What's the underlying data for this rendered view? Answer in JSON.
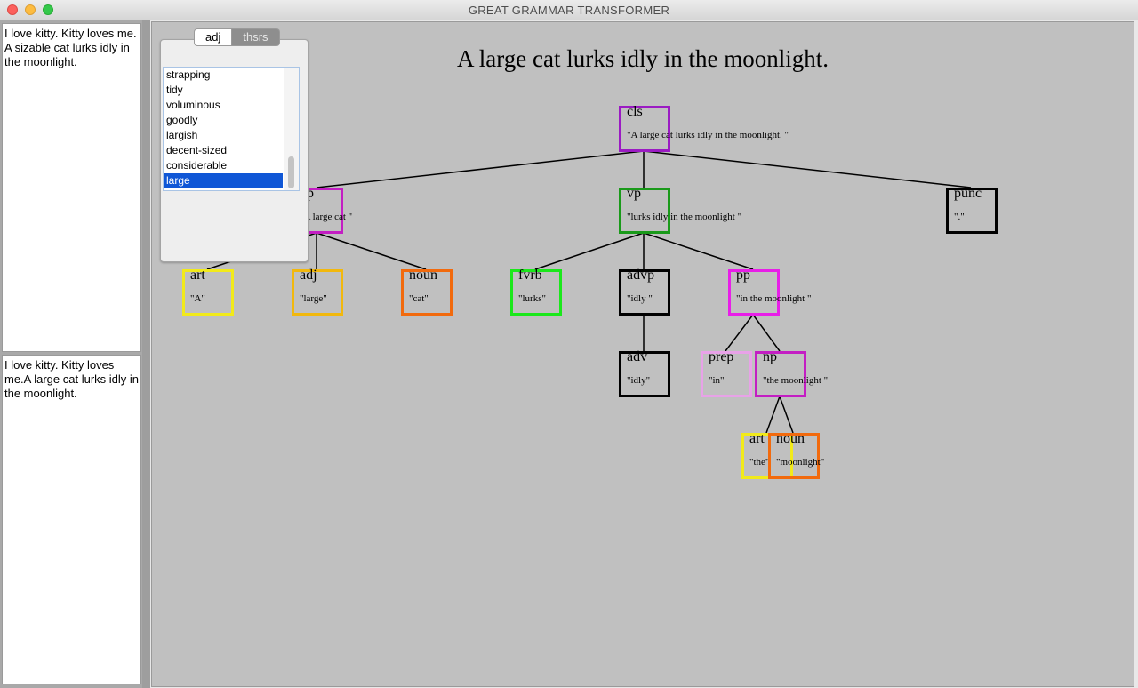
{
  "window": {
    "title": "GREAT GRAMMAR TRANSFORMER"
  },
  "left": {
    "top_text": "I love kitty. Kitty loves me. A sizable cat lurks idly in the moonlight.",
    "bottom_text": "I love kitty. Kitty loves me.A large cat lurks idly in the moonlight."
  },
  "sentence": "A large cat lurks idly in the moonlight.",
  "thesaurus": {
    "tabs": [
      "adj",
      "thsrs"
    ],
    "items": [
      "strapping",
      "tidy",
      "voluminous",
      "goodly",
      "largish",
      "decent-sized",
      "considerable",
      "large"
    ],
    "selected": "large"
  },
  "tree": {
    "cls": {
      "label": "cls",
      "text": "\"A large cat lurks idly in the moonlight. \"",
      "color": "#9b1bc3"
    },
    "np": {
      "label": "np",
      "text": "\"A large cat \"",
      "color": "#c31ec3"
    },
    "vp": {
      "label": "vp",
      "text": "\"lurks idly in the moonlight \"",
      "color": "#1a9a1a"
    },
    "punc": {
      "label": "punc",
      "text": "\".\"",
      "color": "#000000"
    },
    "art1": {
      "label": "art",
      "text": "\"A\"",
      "color": "#f2ea1a"
    },
    "adj": {
      "label": "adj",
      "text": "\"large\"",
      "color": "#f2b80d"
    },
    "noun1": {
      "label": "noun",
      "text": "\"cat\"",
      "color": "#f26a0d"
    },
    "fvrb": {
      "label": "fvrb",
      "text": "\"lurks\"",
      "color": "#1be81b"
    },
    "advp": {
      "label": "advp",
      "text": "\"idly \"",
      "color": "#000000"
    },
    "pp": {
      "label": "pp",
      "text": "\"in the moonlight \"",
      "color": "#e81ee8"
    },
    "adv": {
      "label": "adv",
      "text": "\"idly\"",
      "color": "#000000"
    },
    "prep": {
      "label": "prep",
      "text": "\"in\"",
      "color": "#e8a2e8"
    },
    "np2": {
      "label": "np",
      "text": "\"the moonlight \"",
      "color": "#c31ec3"
    },
    "art2": {
      "label": "art",
      "text": "\"the\"",
      "color": "#f2ea1a"
    },
    "noun2": {
      "label": "noun",
      "text": "\"moonlight\"",
      "color": "#f26a0d"
    }
  }
}
